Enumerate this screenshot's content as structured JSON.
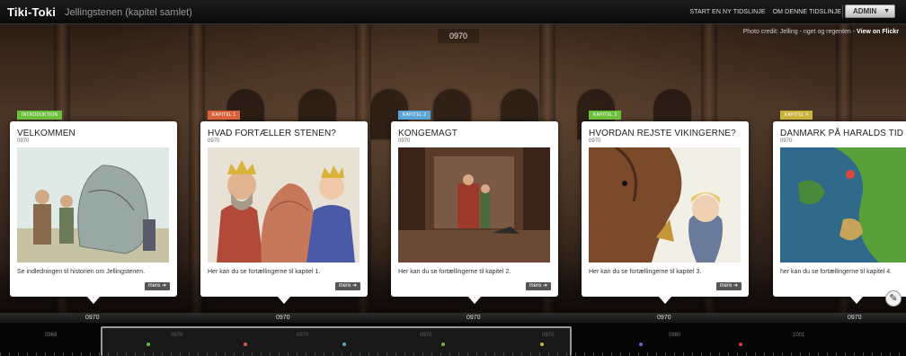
{
  "app": {
    "brand": "Tiki-Toki",
    "timeline_title": "Jellingstenen (kapitel samlet)"
  },
  "topnav": {
    "items": [
      "START EN NY TIDSLINJE",
      "OM DENNE TIDSLINJE"
    ],
    "admin_label": "ADMIN"
  },
  "header": {
    "current_date": "0970"
  },
  "credit": {
    "prefix": "Photo credit: Jelling - nget og regenten -",
    "link": "View on Flickr"
  },
  "cards": [
    {
      "tag": "INTRODUKTION",
      "tag_color": "#6bbf3a",
      "title": "VELKOMMEN",
      "date": "0970",
      "text": "Se indledningen til historien om Jellingstenen.",
      "more": "mere"
    },
    {
      "tag": "KAPITEL 1",
      "tag_color": "#d9623b",
      "title": "HVAD FORTÆLLER STENEN?",
      "date": "0970",
      "text": "Her kan du se fortællingerne til kapitel 1.",
      "more": "mere"
    },
    {
      "tag": "KAPITEL 2",
      "tag_color": "#5aa6d6",
      "title": "KONGEMAGT",
      "date": "0970",
      "text": "Her kan du se fortællingerne til kapitel 2.",
      "more": "mere"
    },
    {
      "tag": "KAPITEL 3",
      "tag_color": "#6bbf3a",
      "title": "HVORDAN REJSTE VIKINGERNE?",
      "date": "0970",
      "text": "Her kan du se fortællingerne til kapitel 3.",
      "more": "mere"
    },
    {
      "tag": "KAPITEL 4",
      "tag_color": "#c8b23a",
      "title": "DANMARK PÅ HARALDS TID",
      "date": "0970",
      "text": "her kan du se fortællingerne til kapitel 4.",
      "more": "mere"
    }
  ],
  "markers": [
    "0970",
    "0970",
    "0970",
    "0970",
    "0970"
  ],
  "timeline": {
    "ticks": [
      "0968",
      "0970",
      "0970",
      "0970",
      "0970",
      "0980",
      "1001"
    ],
    "dot_colors": [
      "#5fc23a",
      "#d9623b",
      "#5aa6d6",
      "#6bbf3a",
      "#c8b23a",
      "#7a5ad6",
      "#d93b3b"
    ]
  },
  "icons": {
    "wrench": "wrench-icon",
    "more_arrow": "arrow-right-icon",
    "admin_caret": "caret-down-icon"
  }
}
